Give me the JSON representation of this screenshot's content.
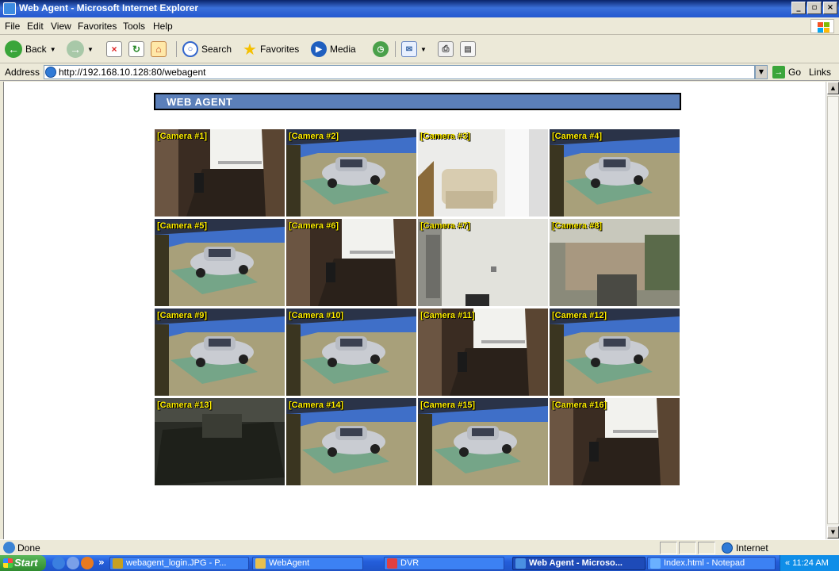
{
  "window": {
    "title": "Web Agent - Microsoft Internet Explorer",
    "minimize": "_",
    "maximize": "▫",
    "close": "×"
  },
  "menu": [
    "File",
    "Edit",
    "View",
    "Favorites",
    "Tools",
    "Help"
  ],
  "toolbar": {
    "back": "Back",
    "search": "Search",
    "favorites": "Favorites",
    "media": "Media"
  },
  "address": {
    "label": "Address",
    "url": "http://192.168.10.128:80/webagent",
    "go": "Go",
    "links": "Links »"
  },
  "page": {
    "banner": "WEB AGENT",
    "cameras": [
      {
        "label": "[Camera #1]",
        "scene": "hallway"
      },
      {
        "label": "[Camera #2]",
        "scene": "car"
      },
      {
        "label": "[Camera #3]",
        "scene": "chair"
      },
      {
        "label": "[Camera #4]",
        "scene": "car"
      },
      {
        "label": "[Camera #5]",
        "scene": "car"
      },
      {
        "label": "[Camera #6]",
        "scene": "hallway"
      },
      {
        "label": "[Camera #7]",
        "scene": "room"
      },
      {
        "label": "[Camera #8]",
        "scene": "office"
      },
      {
        "label": "[Camera #9]",
        "scene": "car"
      },
      {
        "label": "[Camera #10]",
        "scene": "car"
      },
      {
        "label": "[Camera #11]",
        "scene": "hallway"
      },
      {
        "label": "[Camera #12]",
        "scene": "car"
      },
      {
        "label": "[Camera #13]",
        "scene": "dark"
      },
      {
        "label": "[Camera #14]",
        "scene": "car"
      },
      {
        "label": "[Camera #15]",
        "scene": "car"
      },
      {
        "label": "[Camera #16]",
        "scene": "hallway"
      }
    ]
  },
  "status": {
    "text": "Done",
    "zone": "Internet"
  },
  "taskbar": {
    "start": "Start",
    "chevron": "»",
    "tasks": [
      {
        "label": "webagent_login.JPG - P...",
        "active": false,
        "icon_color": "#c8a020"
      },
      {
        "label": "WebAgent",
        "active": false,
        "icon_color": "#e8c050"
      },
      {
        "label": "DVR",
        "active": false,
        "icon_color": "#e04040"
      },
      {
        "label": "Web Agent - Microso...",
        "active": true,
        "icon_color": "#4a90e2"
      },
      {
        "label": "Index.html - Notepad",
        "active": false,
        "icon_color": "#6ab0ff"
      }
    ],
    "clock": "« 11:24 AM"
  }
}
